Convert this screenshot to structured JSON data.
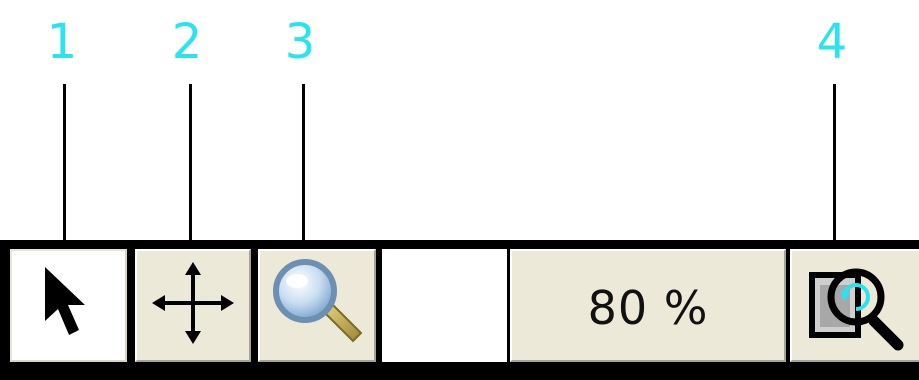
{
  "callouts": [
    {
      "number": "1",
      "target": "pointer-tool"
    },
    {
      "number": "2",
      "target": "pan-tool"
    },
    {
      "number": "3",
      "target": "zoom-tool"
    },
    {
      "number": "4",
      "target": "zoom-to-fit-tool"
    }
  ],
  "colors": {
    "callout": "#29e4ee",
    "toolbar_border": "#000000",
    "button_face": "#ece9d8",
    "selected_face": "#ffffff"
  },
  "toolbar": {
    "tools": [
      {
        "id": "pointer",
        "icon": "arrow-pointer-icon",
        "selected": true
      },
      {
        "id": "pan",
        "icon": "move-arrows-icon",
        "selected": false
      },
      {
        "id": "zoom",
        "icon": "magnifier-icon",
        "selected": false
      },
      {
        "id": "zoom-to-fit",
        "icon": "zoom-page-icon",
        "selected": false
      }
    ],
    "zoom_level": "80 %"
  }
}
